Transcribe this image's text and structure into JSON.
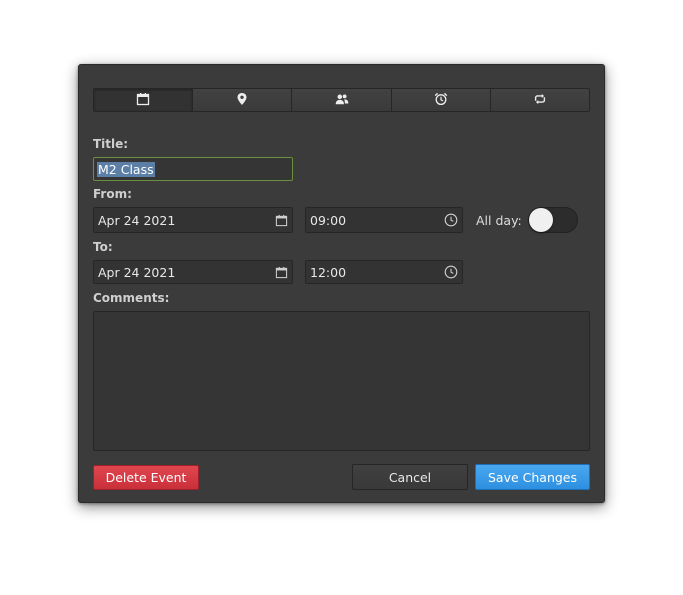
{
  "tabs": [
    {
      "icon": "calendar-icon",
      "active": true
    },
    {
      "icon": "location-pin-icon",
      "active": false
    },
    {
      "icon": "attendees-icon",
      "active": false
    },
    {
      "icon": "alarm-clock-icon",
      "active": false
    },
    {
      "icon": "repeat-icon",
      "active": false
    }
  ],
  "form": {
    "title_label": "Title:",
    "title_value": "M2 Class",
    "from_label": "From:",
    "from_date": "Apr 24 2021",
    "from_time": "09:00",
    "all_day_label": "All day:",
    "all_day_on": false,
    "to_label": "To:",
    "to_date": "Apr 24 2021",
    "to_time": "12:00",
    "comments_label": "Comments:",
    "comments_value": ""
  },
  "buttons": {
    "delete": "Delete Event",
    "cancel": "Cancel",
    "save": "Save Changes"
  },
  "colors": {
    "dialog_bg": "#3b3b3b",
    "delete_red": "#d63a43",
    "save_blue": "#3a9be8",
    "focus_green": "#6a8f3e"
  }
}
